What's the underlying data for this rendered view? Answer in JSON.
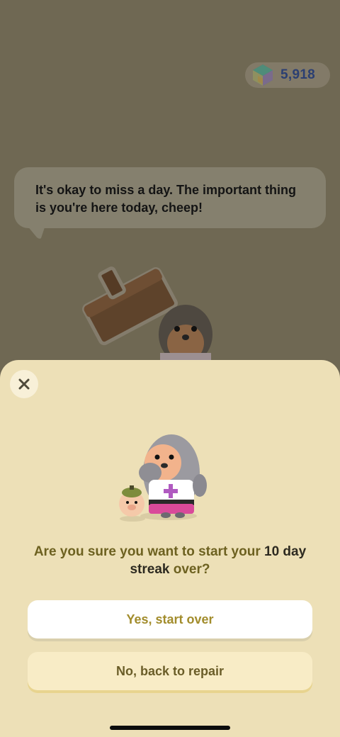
{
  "header": {
    "gem_count": "5,918",
    "gem_icon": "gem-icon"
  },
  "speech": {
    "text": "It's okay to miss a day. The important thing is you're here today, cheep!"
  },
  "dialog": {
    "close_icon": "close-icon",
    "question_prefix": "Are you sure you want to start your ",
    "question_emphasis": "10 day streak",
    "question_suffix": " over?",
    "confirm_label": "Yes, start over",
    "back_label": "No, back to repair"
  },
  "colors": {
    "background_dim": "#6f6853",
    "sheet": "#ede0b7",
    "accent_gold": "#a28c2c",
    "gem_text": "#2b3f72"
  }
}
